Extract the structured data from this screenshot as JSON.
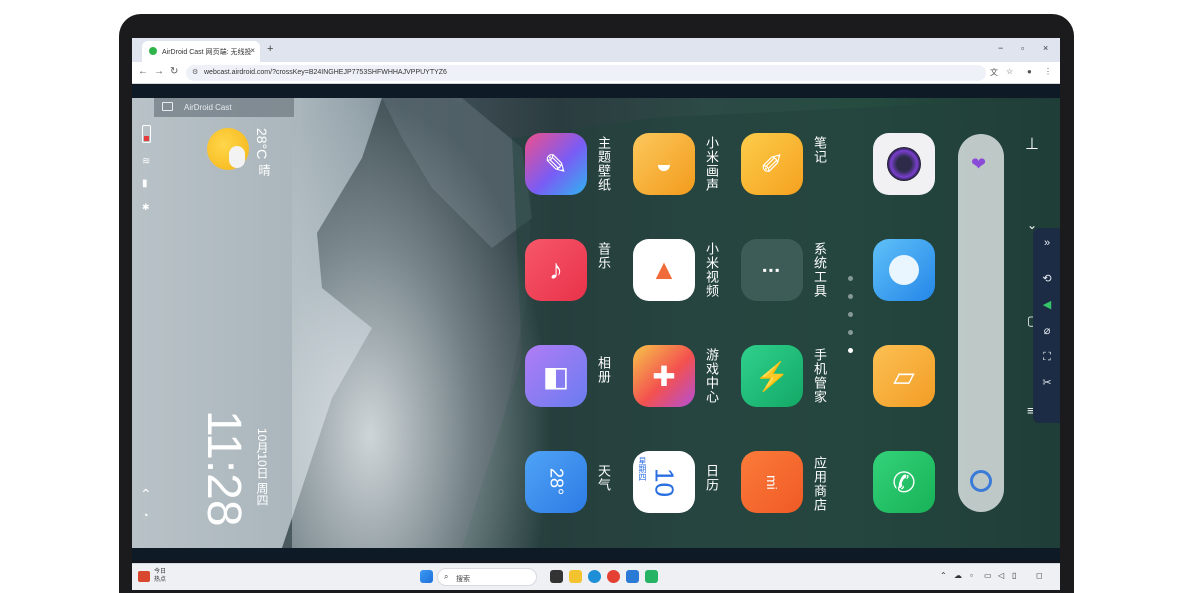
{
  "browser": {
    "tab_title": "AirDroid Cast 网页端: 无线投",
    "tab_close": "×",
    "new_tab": "+",
    "url": "webcast.airdroid.com/?crossKey=B24INGHEJP7753SHFWHHAJVPPUYTYZ6",
    "window_controls": [
      "−",
      "▫",
      "×"
    ]
  },
  "cast_overlay": {
    "label": "AirDroid Cast"
  },
  "phone": {
    "weather": {
      "temp": "28°C",
      "condition": "晴"
    },
    "clock": {
      "time": "11:28",
      "date": "10月10日 周四"
    },
    "apps": [
      {
        "label": "主题壁纸",
        "icon": "brush-icon",
        "color": "#6a5cf0"
      },
      {
        "label": "小米画声",
        "icon": "shell-icon",
        "color": "#f7b42c"
      },
      {
        "label": "笔记",
        "icon": "pencil-icon",
        "color": "#f6b528"
      },
      {
        "label": "",
        "icon": "camera-icon",
        "color": "#f2f2f2"
      },
      {
        "label": "音乐",
        "icon": "music-icon",
        "color": "#f2465a"
      },
      {
        "label": "小米视频",
        "icon": "play-triangle-icon",
        "color": "#ffffff"
      },
      {
        "label": "系统工具",
        "icon": "folder-icon",
        "color": "#3b5a58"
      },
      {
        "label": "",
        "icon": "browser-icon",
        "color": "#2f9bf0"
      },
      {
        "label": "相册",
        "icon": "gallery-icon",
        "color": "#7b6cf0"
      },
      {
        "label": "游戏中心",
        "icon": "gamepad-icon",
        "color": "#f3514f"
      },
      {
        "label": "手机管家",
        "icon": "security-icon",
        "color": "#20c07a"
      },
      {
        "label": "",
        "icon": "notes-icon",
        "color": "#f7a933"
      },
      {
        "label": "天气",
        "icon": "weather-icon",
        "color": "#3c8ff0",
        "badge": "28°"
      },
      {
        "label": "日历",
        "icon": "calendar-icon",
        "color": "#ffffff",
        "badge": "10",
        "sub": "星期四"
      },
      {
        "label": "应用商店",
        "icon": "store-icon",
        "color": "#f5682c",
        "badge": "mi"
      },
      {
        "label": "",
        "icon": "phone-icon",
        "color": "#1ec060"
      }
    ]
  },
  "taskbar": {
    "news": [
      "今日",
      "热点"
    ],
    "search_placeholder": "搜索"
  }
}
